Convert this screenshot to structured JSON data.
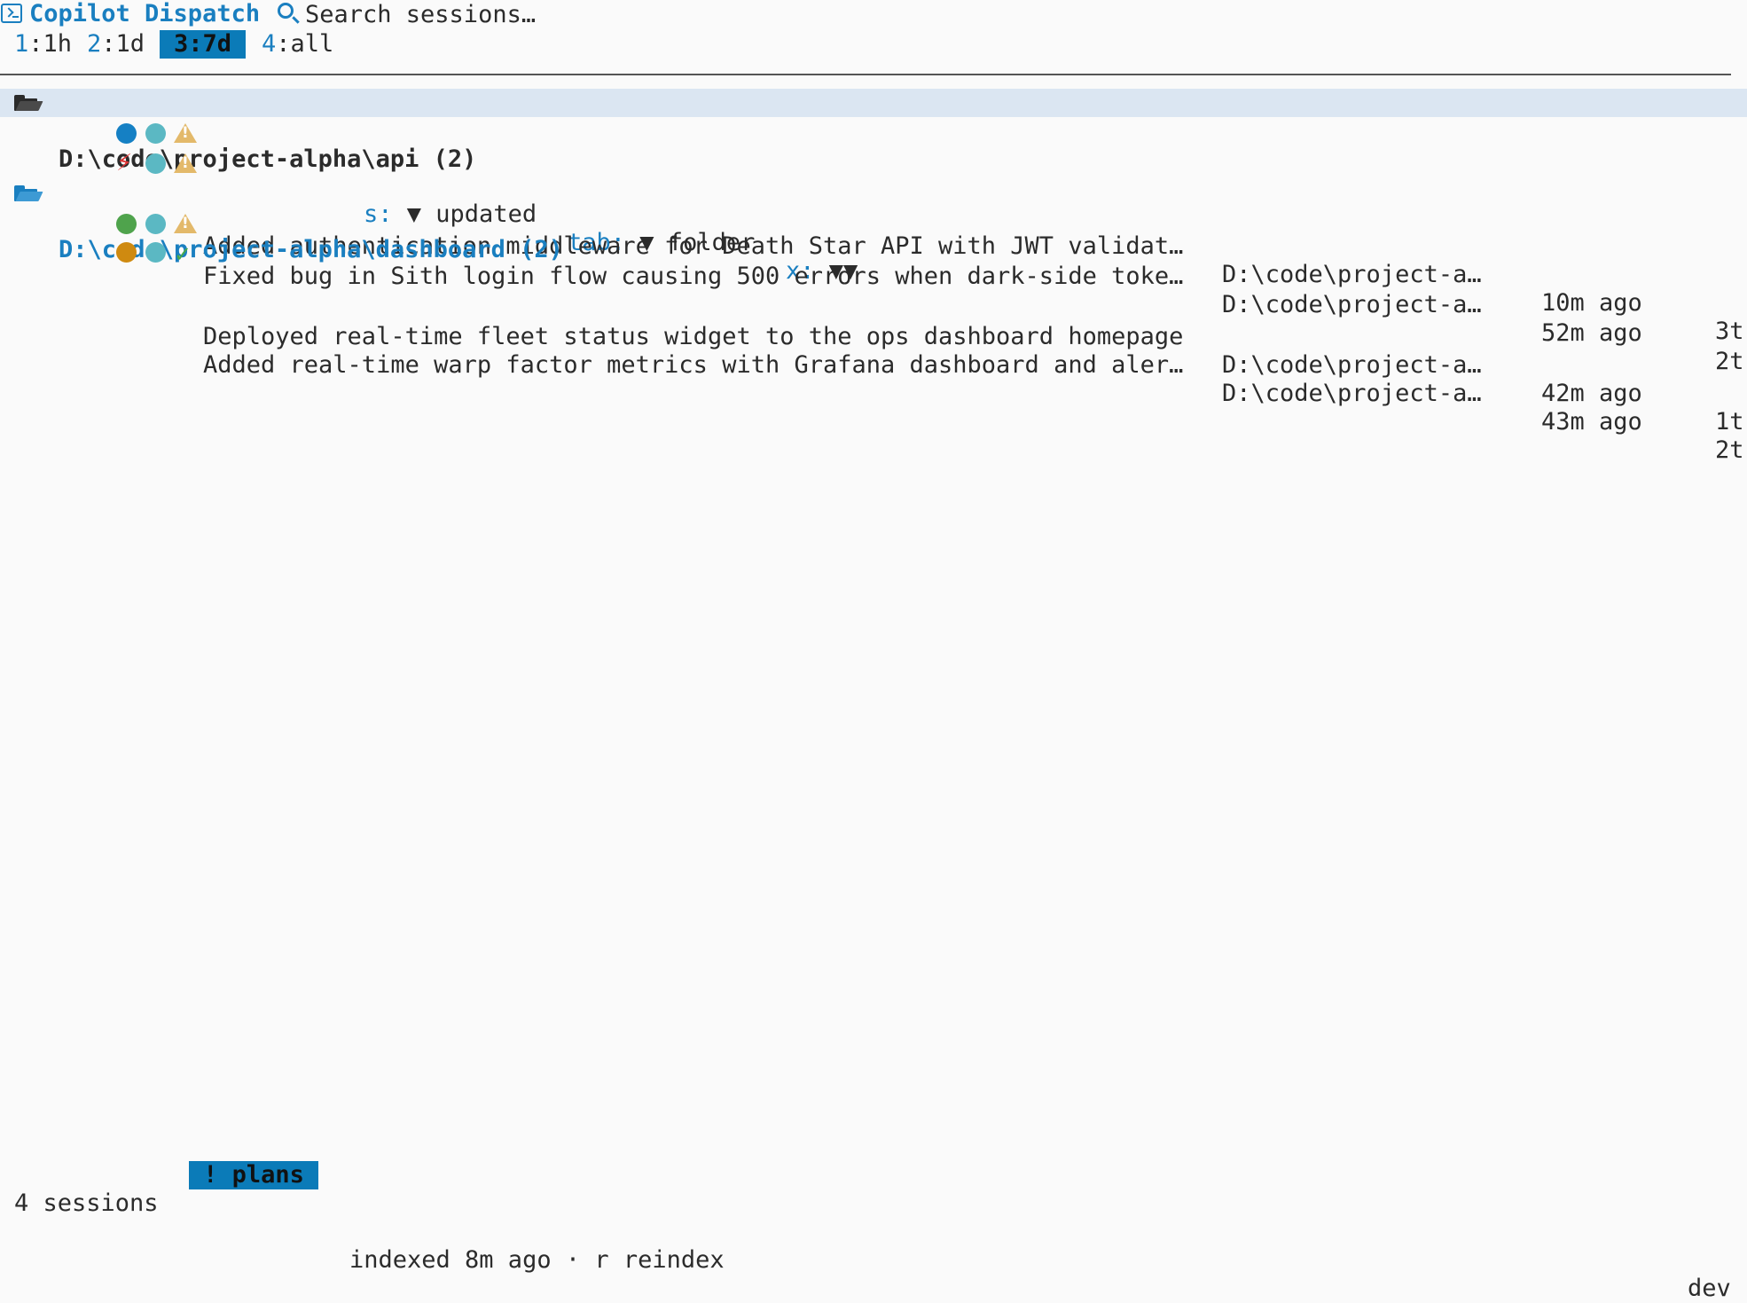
{
  "header": {
    "app_title": "Copilot Dispatch",
    "search_placeholder": "Search sessions…"
  },
  "toolbar": {
    "time_filters": [
      {
        "key": "1",
        "label": ":1h"
      },
      {
        "key": "2",
        "label": ":1d"
      },
      {
        "key": "3",
        "label": ":7d",
        "selected": true
      },
      {
        "key": "4",
        "label": ":all"
      }
    ],
    "sort": {
      "key": "s:",
      "value": "▼ updated"
    },
    "group": {
      "key": "tab:",
      "value": "▼ folder"
    },
    "collapse": {
      "key": "x:",
      "value": "▼▼"
    }
  },
  "groups": [
    {
      "label": "D:\\code\\project-alpha\\api (2)",
      "expanded": true,
      "sessions": [
        {
          "status": "blue",
          "second": "teal",
          "badge": "warning-icon",
          "title": "Added authentication middleware for Death Star API with JWT validat…",
          "path": "D:\\code\\project-a…",
          "updated": "10m ago",
          "turns": "3t"
        },
        {
          "status": "bolt",
          "second": "teal",
          "badge": "warning-icon",
          "title": "Fixed bug in Sith login flow causing 500 errors when dark-side toke…",
          "path": "D:\\code\\project-a…",
          "updated": "52m ago",
          "turns": "2t"
        }
      ]
    },
    {
      "label": "D:\\code\\project-alpha\\dashboard (2)",
      "expanded": true,
      "sessions": [
        {
          "status": "green",
          "second": "teal",
          "badge": "warning-icon",
          "title": "Deployed real-time fleet status widget to the ops dashboard homepage",
          "path": "D:\\code\\project-a…",
          "updated": "42m ago",
          "turns": "1t"
        },
        {
          "status": "amber",
          "second": "teal",
          "badge": "check-icon",
          "title": "Added real-time warp factor metrics with Grafana dashboard and aler…",
          "path": "D:\\code\\project-a…",
          "updated": "43m ago",
          "turns": "2t"
        }
      ]
    }
  ],
  "footer": {
    "session_count": "4 sessions",
    "plans_badge": "! plans",
    "index_status": "indexed 8m ago · r reindex",
    "env": "dev"
  },
  "colors": {
    "accent": "#1a7fc0",
    "selected_bg": "#0b7bb8",
    "group_highlight": "#dbe6f2",
    "status_blue": "#1580c4",
    "status_teal": "#5bb8c3",
    "status_green": "#4fa34c",
    "status_amber": "#cf8a10",
    "warning": "#e3b96a",
    "error": "#e03434"
  }
}
